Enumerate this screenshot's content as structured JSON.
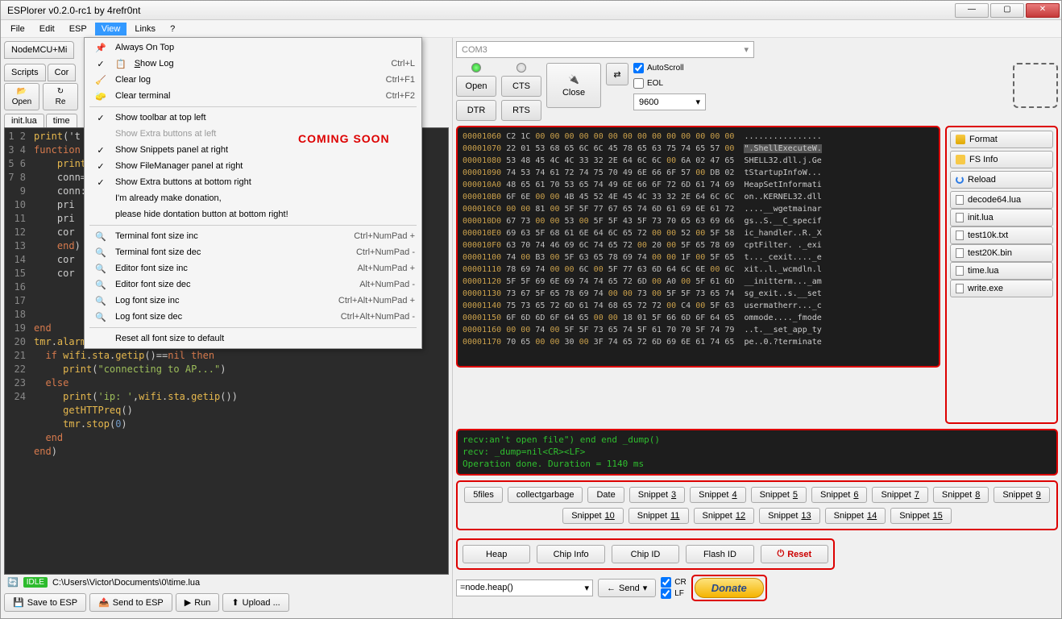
{
  "window": {
    "title": "ESPlorer v0.2.0-rc1 by 4refr0nt"
  },
  "menubar": [
    "File",
    "Edit",
    "ESP",
    "View",
    "Links",
    "?"
  ],
  "leftTabs": {
    "node": "NodeMCU+Mi",
    "scripts": "Scripts",
    "commands": "Cor"
  },
  "toolbtns": {
    "open": "Open",
    "re": "Re"
  },
  "fileTabs": [
    "init.lua",
    "time"
  ],
  "viewMenu": {
    "alwaysOnTop": "Always On Top",
    "showLog": "Show Log",
    "showLogKey": "Ctrl+L",
    "clearLog": "Clear log",
    "clearLogKey": "Ctrl+F1",
    "clearTerm": "Clear terminal",
    "clearTermKey": "Ctrl+F2",
    "showToolbar": "Show toolbar at top left",
    "showExtraLeft": "Show Extra buttons at left",
    "showSnippets": "Show Snippets panel at right",
    "showFM": "Show FileManager panel at right",
    "showExtraBR": "Show Extra buttons at bottom right",
    "donated1": "I'm already make donation,",
    "donated2": "please hide dontation button at bottom right!",
    "tfinc": "Terminal font size inc",
    "tfincKey": "Ctrl+NumPad +",
    "tfdec": "Terminal font size dec",
    "tfdecKey": "Ctrl+NumPad -",
    "efinc": "Editor font size inc",
    "efincKey": "Alt+NumPad +",
    "efdec": "Editor font size dec",
    "efdecKey": "Alt+NumPad -",
    "lfinc": "Log font size inc",
    "lfincKey": "Ctrl+Alt+NumPad +",
    "lfdec": "Log font size dec",
    "lfdecKey": "Ctrl+Alt+NumPad -",
    "resetFonts": "Reset all font size to default"
  },
  "comingSoon": "COMING SOON",
  "editor": {
    "lines": 24,
    "code": [
      "print('t",
      "function",
      "    print",
      "    conn=",
      "    conn:",
      "    pri",
      "    pri",
      "    cor",
      "    end)",
      "    cor",
      "    cor",
      "",
      "",
      "",
      "end",
      "tmr.alarm(0, 1000, 1, function()",
      "  if wifi.sta.getip()==nil then",
      "     print(\"connecting to AP...\")",
      "  else",
      "     print('ip: ',wifi.sta.getip())",
      "     getHTTPreq()",
      "     tmr.stop(0)",
      "  end",
      "end)"
    ]
  },
  "status": {
    "idle": "IDLE",
    "path": "C:\\Users\\Victor\\Documents\\0\\time.lua"
  },
  "bottomBtns": {
    "save": "Save to ESP",
    "send": "Send to ESP",
    "run": "Run",
    "upload": "Upload ..."
  },
  "com": {
    "port": "COM3",
    "open": "Open",
    "cts": "CTS",
    "close": "Close",
    "dtr": "DTR",
    "rts": "RTS",
    "autoscroll": "AutoScroll",
    "eol": "EOL",
    "baud": "9600"
  },
  "hex": [
    {
      "a": "00001060",
      "b": "C2 1C 00 00 00 00 00 00 00 00 00 00 00 00 00 00",
      "t": "................"
    },
    {
      "a": "00001070",
      "b": "22 01 53 68 65 6C 6C 45 78 65 63 75 74 65 57 00",
      "t": "\".ShellExecuteW.",
      "hi": true
    },
    {
      "a": "00001080",
      "b": "53 48 45 4C 4C 33 32 2E 64 6C 6C 00 6A 02 47 65",
      "t": "SHELL32.dll.j.Ge"
    },
    {
      "a": "00001090",
      "b": "74 53 74 61 72 74 75 70 49 6E 66 6F 57 00 DB 02",
      "t": "tStartupInfoW..."
    },
    {
      "a": "000010A0",
      "b": "48 65 61 70 53 65 74 49 6E 66 6F 72 6D 61 74 69",
      "t": "HeapSetInformati"
    },
    {
      "a": "000010B0",
      "b": "6F 6E 00 00 4B 45 52 4E 45 4C 33 32 2E 64 6C 6C",
      "t": "on..KERNEL32.dll"
    },
    {
      "a": "000010C0",
      "b": "00 00 81 00 5F 5F 77 67 65 74 6D 61 69 6E 61 72",
      "t": "....__wgetmainar"
    },
    {
      "a": "000010D0",
      "b": "67 73 00 00 53 00 5F 5F 43 5F 73 70 65 63 69 66",
      "t": "gs..S.__C_specif"
    },
    {
      "a": "000010E0",
      "b": "69 63 5F 68 61 6E 64 6C 65 72 00 00 52 00 5F 58",
      "t": "ic_handler..R._X"
    },
    {
      "a": "000010F0",
      "b": "63 70 74 46 69 6C 74 65 72 00 20 00 5F 65 78 69",
      "t": "cptFilter. ._exi"
    },
    {
      "a": "00001100",
      "b": "74 00 B3 00 5F 63 65 78 69 74 00 00 1F 00 5F 65",
      "t": "t..._cexit...._e"
    },
    {
      "a": "00001110",
      "b": "78 69 74 00 00 6C 00 5F 77 63 6D 64 6C 6E 00 6C",
      "t": "xit..l._wcmdln.l"
    },
    {
      "a": "00001120",
      "b": "5F 5F 69 6E 69 74 74 65 72 6D 00 A0 00 5F 61 6D",
      "t": "__initterm..._am"
    },
    {
      "a": "00001130",
      "b": "73 67 5F 65 78 69 74 00 00 73 00 5F 5F 73 65 74",
      "t": "sg_exit..s.__set"
    },
    {
      "a": "00001140",
      "b": "75 73 65 72 6D 61 74 68 65 72 72 00 C4 00 5F 63",
      "t": "usermatherr..._c"
    },
    {
      "a": "00001150",
      "b": "6F 6D 6D 6F 64 65 00 00 18 01 5F 66 6D 6F 64 65",
      "t": "ommode...._fmode"
    },
    {
      "a": "00001160",
      "b": "00 00 74 00 5F 5F 73 65 74 5F 61 70 70 5F 74 79",
      "t": "..t.__set_app_ty"
    },
    {
      "a": "00001170",
      "b": "70 65 00 00 30 00 3F 74 65 72 6D 69 6E 61 74 65",
      "t": "pe..0.?terminate"
    }
  ],
  "filePanel": {
    "format": "Format",
    "fsinfo": "FS Info",
    "reload": "Reload",
    "files": [
      "decode64.lua",
      "init.lua",
      "test10k.txt",
      "test20K.bin",
      "time.lua",
      "write.exe"
    ]
  },
  "loglines": [
    "recv:an't open file\") end end _dump()",
    "recv: _dump=nil<CR><LF>",
    "Operation done. Duration = 1140 ms"
  ],
  "snippets": [
    "5files",
    "collectgarbage",
    "Date",
    "Snippet3",
    "Snippet4",
    "Snippet5",
    "Snippet6",
    "Snippet7",
    "Snippet8",
    "Snippet9",
    "Snippet10",
    "Snippet11",
    "Snippet12",
    "Snippet13",
    "Snippet14",
    "Snippet15"
  ],
  "ext": {
    "heap": "Heap",
    "chipinfo": "Chip Info",
    "chipid": "Chip ID",
    "flashid": "Flash ID",
    "reset": "Reset"
  },
  "send": {
    "input": "=node.heap()",
    "btn": "Send",
    "cr": "CR",
    "lf": "LF",
    "donate": "Donate"
  }
}
